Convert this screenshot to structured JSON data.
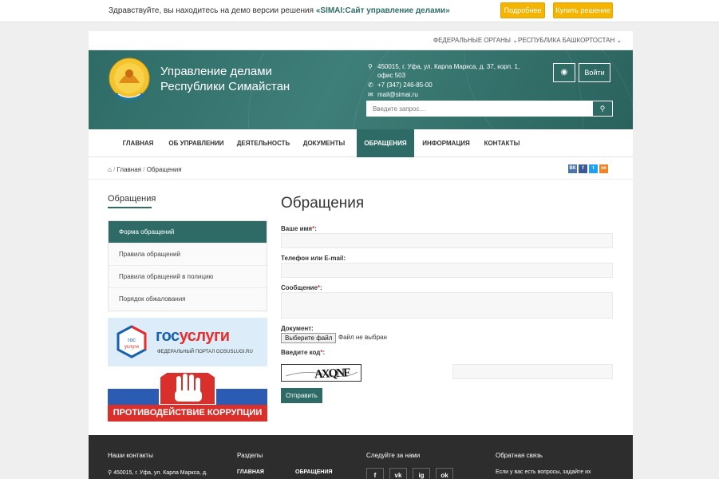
{
  "demo": {
    "text_prefix": "Здравствуйте, вы находитесь на демо версии решения ",
    "solution": "«SIMAI:Сайт управление делами»",
    "more_label": "Подробнее",
    "buy_label": "Купить решение"
  },
  "topnav": {
    "federal": "ФЕДЕРАЛЬНЫЕ ОРГАНЫ",
    "republic": "РЕСПУБЛИКА БАШКОРТОСТАН"
  },
  "header": {
    "title": "Управление делами Республики Симайстан",
    "address": "450015, г. Уфа, ул. Карла Маркса, д. 37, корп. 1, офис 503",
    "phone": "+7 (347) 246-85-00",
    "email": "mail@simai.ru",
    "login_label": "Войти",
    "search_placeholder": "Введите запрос..."
  },
  "mainnav": {
    "items": [
      "ГЛАВНАЯ",
      "ОБ УПРАВЛЕНИИ",
      "ДЕЯТЕЛЬНОСТЬ",
      "ДОКУМЕНТЫ",
      "ОБРАЩЕНИЯ",
      "ИНФОРМАЦИЯ",
      "КОНТАКТЫ"
    ]
  },
  "breadcrumb": {
    "home": "Главная",
    "current": "Обращения"
  },
  "share": [
    "ВК",
    "f",
    "t",
    "ок"
  ],
  "sidebar": {
    "title": "Обращения",
    "items": [
      "Форма обращений",
      "Правила обращений",
      "Правила обращений в полицию",
      "Порядок обжалования"
    ]
  },
  "banners": {
    "gos_brand_1": "гос",
    "gos_brand_2": "услуги",
    "gos_logo_1": "гос",
    "gos_logo_2": "услуги",
    "gos_sub": "ФЕДЕРАЛЬНЫЙ ПОРТАЛ GOSUSLUGI.RU",
    "corruption": "ПРОТИВОДЕЙСТВИЕ КОРРУПЦИИ"
  },
  "form": {
    "title": "Обращения",
    "name_label": "Ваше имя",
    "contact_label": "Телефон или E-mail:",
    "message_label": "Сообщение",
    "document_label": "Документ:",
    "file_button": "Выберите файл",
    "file_status": "Файл не выбран",
    "code_label": "Введите код",
    "captcha_text": "AXQNF",
    "submit_label": "Отправить",
    "required_mark": "*",
    "colon": ":"
  },
  "footer": {
    "contacts_title": "Наши контакты",
    "contacts_address": "450015, г. Уфа, ул. Карла Маркса, д.",
    "sections_title": "Разделы",
    "sections_item_1": "ГЛАВНАЯ",
    "sections_item_2": "ОБРАЩЕНИЯ",
    "follow_title": "Следуйте за нами",
    "social": [
      "f",
      "vk",
      "ig",
      "ok"
    ],
    "feedback_title": "Обратная связь",
    "feedback_text": "Если у вас есть вопросы, задайте их"
  },
  "colors": {
    "accent": "#2e6b66",
    "warning": "#f4b400",
    "footer_bg": "#2d2d2d"
  }
}
